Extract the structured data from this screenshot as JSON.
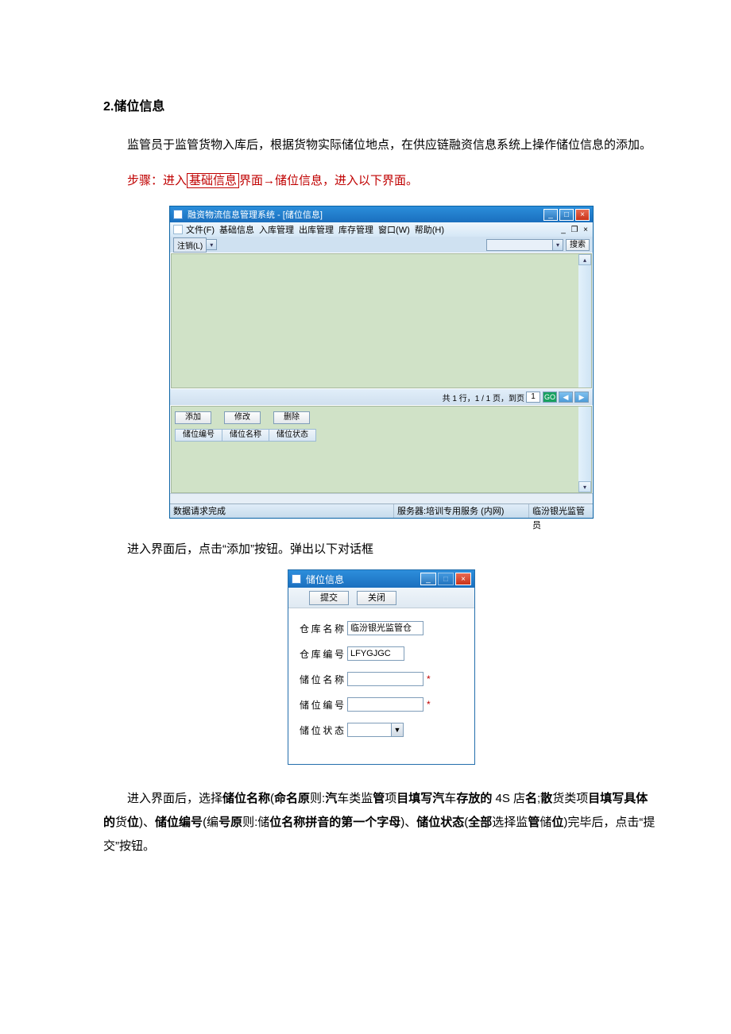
{
  "heading": "2.储位信息",
  "intro": "监管员于监管货物入库后，根据货物实际储位地点，在供应链融资信息系统上操作储位信息的添加。",
  "step_prefix": "步骤：进入",
  "step_basic": "基础信息",
  "step_after": "界面→储位信息，进入以下界面。",
  "mainwin": {
    "title": "融资物流信息管理系统 - [储位信息]",
    "menus": [
      "文件(F)",
      "基础信息",
      "入库管理",
      "出库管理",
      "库存管理",
      "窗口(W)",
      "帮助(H)"
    ],
    "logoff": "注销(L)",
    "search_btn": "搜索",
    "page_info": "共 1 行，1 / 1 页，到页",
    "page_num": "1",
    "go_label": "GO",
    "action_buttons": [
      "添加",
      "修改",
      "删除"
    ],
    "columns": [
      "储位编号",
      "储位名称",
      "储位状态"
    ],
    "status_left": "数据请求完成",
    "status_mid": "服务器:培训专用服务 (内网)",
    "status_right": "临汾银光监管员"
  },
  "after_fig1": "进入界面后，点击“添加”按钮。弹出以下对话框",
  "dialog": {
    "title": "储位信息",
    "btn_submit": "提交",
    "btn_close": "关闭",
    "fields": {
      "warehouse_name_label": "仓库名称",
      "warehouse_name_value": "临汾银光监管仓",
      "warehouse_code_label": "仓库编号",
      "warehouse_code_value": "LFYGJGC",
      "loc_name_label": "储位名称",
      "loc_code_label": "储位编号",
      "loc_status_label": "储位状态"
    }
  },
  "final_para_parts": {
    "p1": "进入界面后，选择",
    "b1": "储位名称",
    "p2": "(",
    "b2": "命名原",
    "p3": "则:",
    "b3": "汽",
    "p4": "车类监",
    "b4": "管",
    "p5": "项",
    "b5": "目填写汽",
    "p6": "车",
    "b6": "存放的",
    "p7": " 4S 店",
    "b7": "名",
    "p8": ";",
    "b8": "散",
    "p9": "货类项",
    "b9": "目填写具体的",
    "p10": "货",
    "b10": "位",
    "p11": ")、",
    "b11": "储位编号",
    "p12": "(编",
    "b12": "号原",
    "p13": "则:储",
    "b13": "位名称拼音的第一个字母",
    "p14": ")、",
    "b14": "储位状态",
    "p15": "(",
    "b15": "全部",
    "p16": "选择监",
    "b16": "管",
    "p17": "储",
    "b17": "位",
    "p18": ")完毕后，点击“提交”按钮。"
  }
}
